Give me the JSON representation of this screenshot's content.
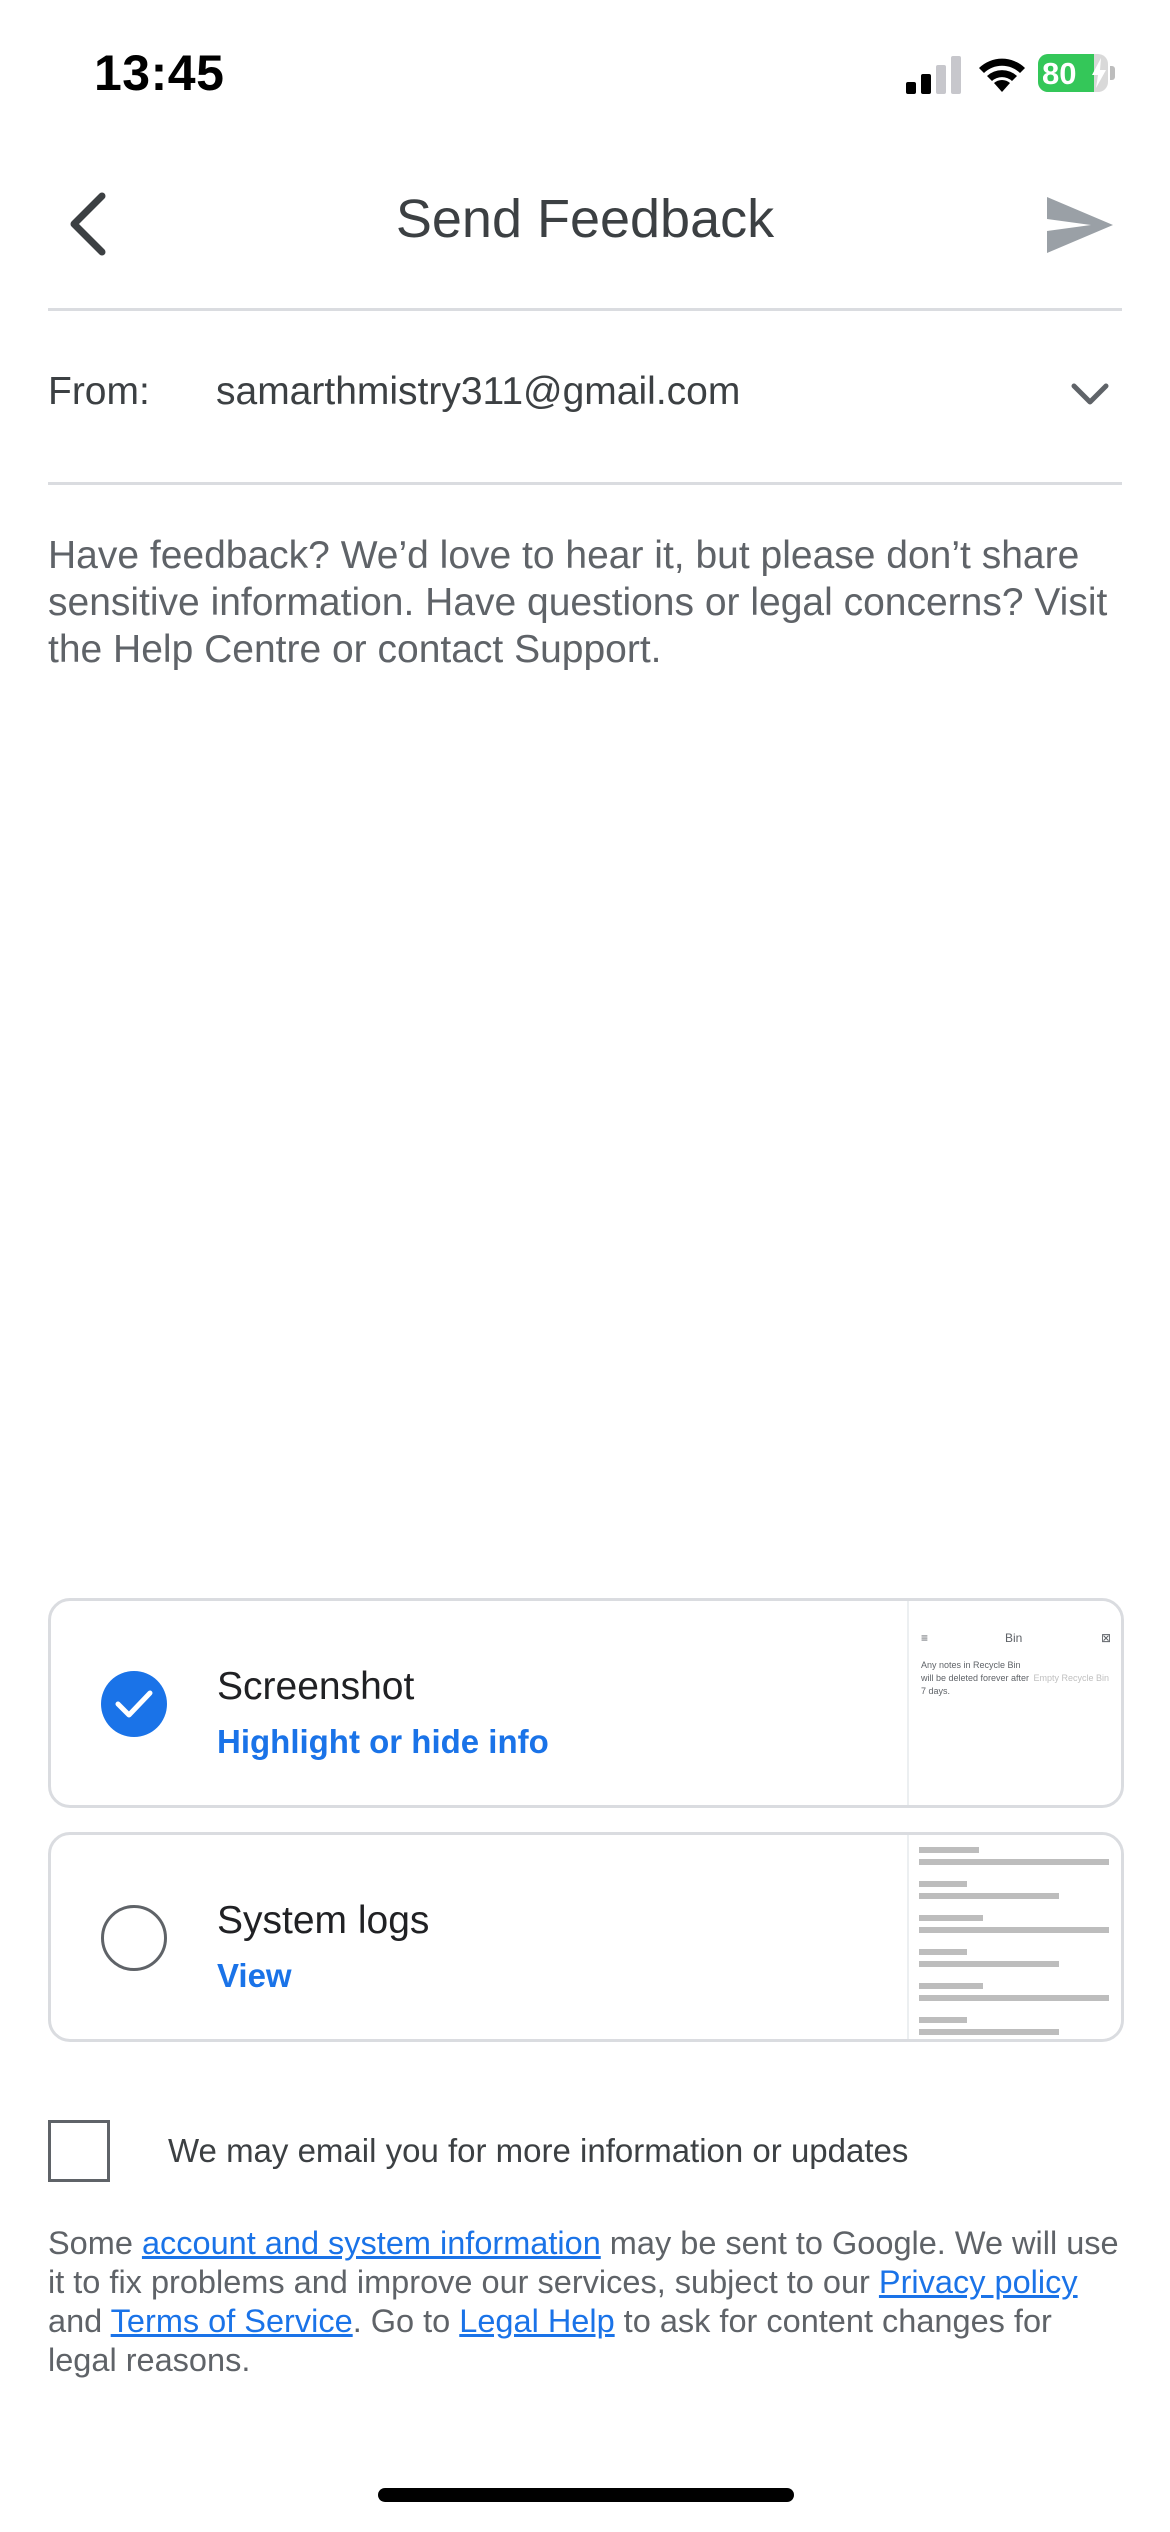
{
  "status_bar": {
    "time": "13:45",
    "battery_level": "80",
    "battery_charging": true,
    "signal_bars_active": 2,
    "signal_bars_total": 4
  },
  "header": {
    "title": "Send Feedback",
    "back_icon": "chevron-left-icon",
    "send_icon": "send-icon"
  },
  "from": {
    "label": "From:",
    "value": "samarthmistry311@gmail.com",
    "dropdown_icon": "chevron-down-icon"
  },
  "feedback": {
    "placeholder": "Have feedback? We’d love to hear it, but please don’t share sensitive information. Have questions or legal concerns? Visit the Help Centre or contact Support.",
    "value": ""
  },
  "attachments": [
    {
      "title": "Screenshot",
      "action": "Highlight or hide info",
      "checked": true,
      "thumbnail": {
        "menu_glyph": "≡",
        "title": "Bin",
        "more_glyph": "⊠",
        "note": "Any notes in Recycle Bin will be deleted forever after 7 days.",
        "action": "Empty Recycle Bin"
      }
    },
    {
      "title": "System logs",
      "action": "View",
      "checked": false
    }
  ],
  "consent": {
    "label": "We may email you for more information or updates",
    "checked": false
  },
  "disclaimer": {
    "part1": "Some ",
    "link1": "account and system information",
    "part2": " may be sent to Google. We will use it to fix problems and improve our services, subject to our ",
    "link2": "Privacy policy",
    "part3": " and ",
    "link3": "Terms of Service",
    "part4": ". Go to ",
    "link4": "Legal Help",
    "part5": " to ask for content changes for legal reasons."
  },
  "colors": {
    "accent": "#1a73e8",
    "text_primary": "#3c4043",
    "text_secondary": "#5f6368",
    "divider": "#dadce0",
    "battery_green": "#34c759"
  }
}
